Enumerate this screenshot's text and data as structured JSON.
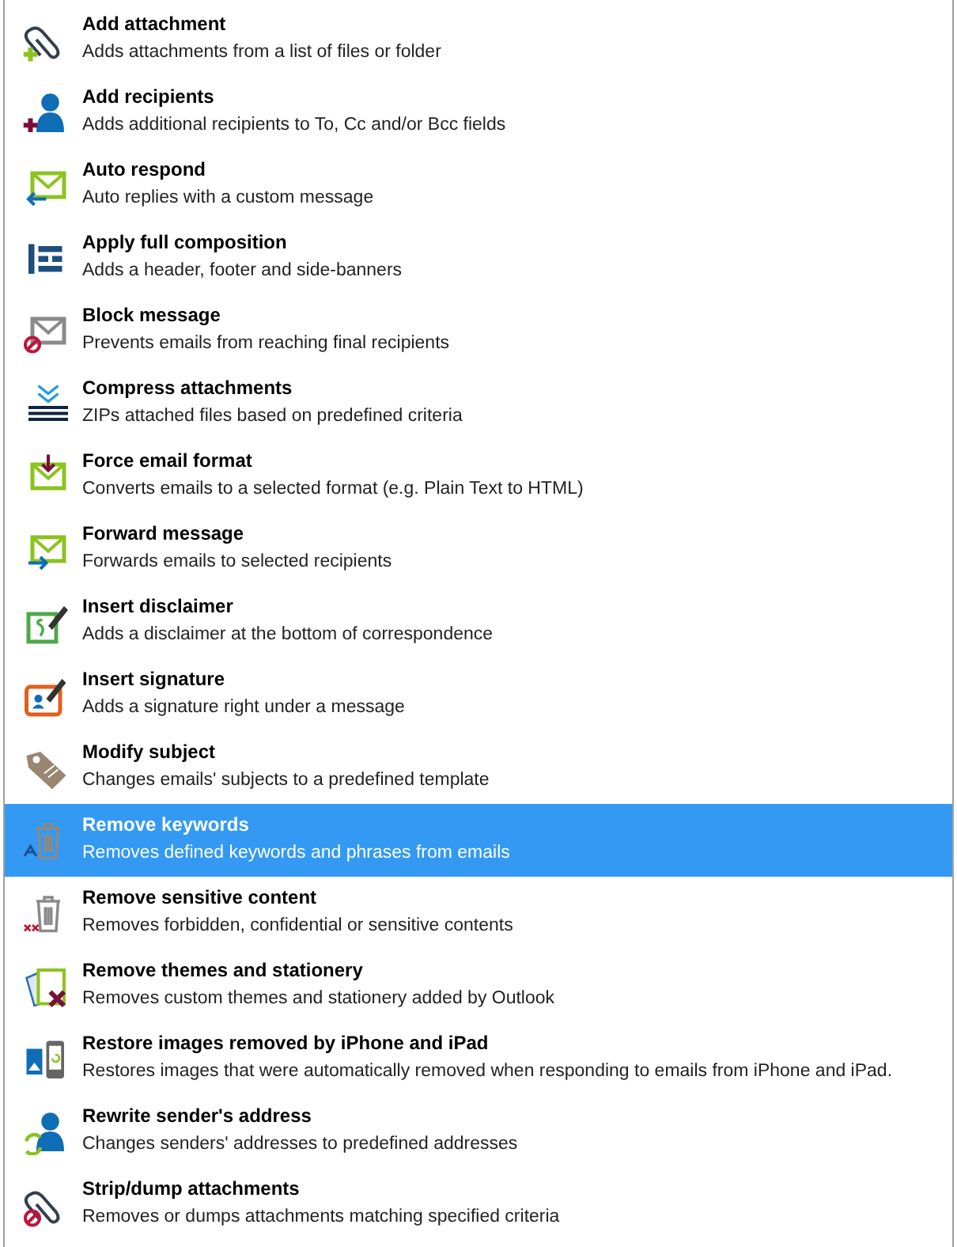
{
  "actions": [
    {
      "title": "Add attachment",
      "description": "Adds attachments from a list of files or folder",
      "selected": false
    },
    {
      "title": "Add recipients",
      "description": "Adds additional recipients to To, Cc and/or Bcc fields",
      "selected": false
    },
    {
      "title": "Auto respond",
      "description": "Auto replies with a custom message",
      "selected": false
    },
    {
      "title": "Apply full composition",
      "description": "Adds a header, footer and side-banners",
      "selected": false
    },
    {
      "title": "Block message",
      "description": "Prevents emails from reaching final recipients",
      "selected": false
    },
    {
      "title": "Compress attachments",
      "description": "ZIPs attached files based on predefined criteria",
      "selected": false
    },
    {
      "title": "Force email format",
      "description": "Converts emails to a selected format (e.g. Plain Text to HTML)",
      "selected": false
    },
    {
      "title": "Forward message",
      "description": "Forwards emails to selected recipients",
      "selected": false
    },
    {
      "title": "Insert disclaimer",
      "description": "Adds a disclaimer at the bottom of correspondence",
      "selected": false
    },
    {
      "title": "Insert signature",
      "description": "Adds a signature right under a message",
      "selected": false
    },
    {
      "title": "Modify subject",
      "description": "Changes emails' subjects to a predefined template",
      "selected": false
    },
    {
      "title": "Remove keywords",
      "description": "Removes defined keywords and phrases from emails",
      "selected": true
    },
    {
      "title": "Remove sensitive content",
      "description": "Removes forbidden, confidential or sensitive contents",
      "selected": false
    },
    {
      "title": "Remove themes and stationery",
      "description": "Removes custom themes and stationery added by Outlook",
      "selected": false
    },
    {
      "title": "Restore images removed by iPhone and iPad",
      "description": "Restores images that were automatically removed when responding to emails from iPhone and iPad.",
      "selected": false
    },
    {
      "title": "Rewrite sender's address",
      "description": "Changes senders' addresses to predefined addresses",
      "selected": false
    },
    {
      "title": "Strip/dump attachments",
      "description": "Removes or dumps attachments matching specified criteria",
      "selected": false
    }
  ]
}
